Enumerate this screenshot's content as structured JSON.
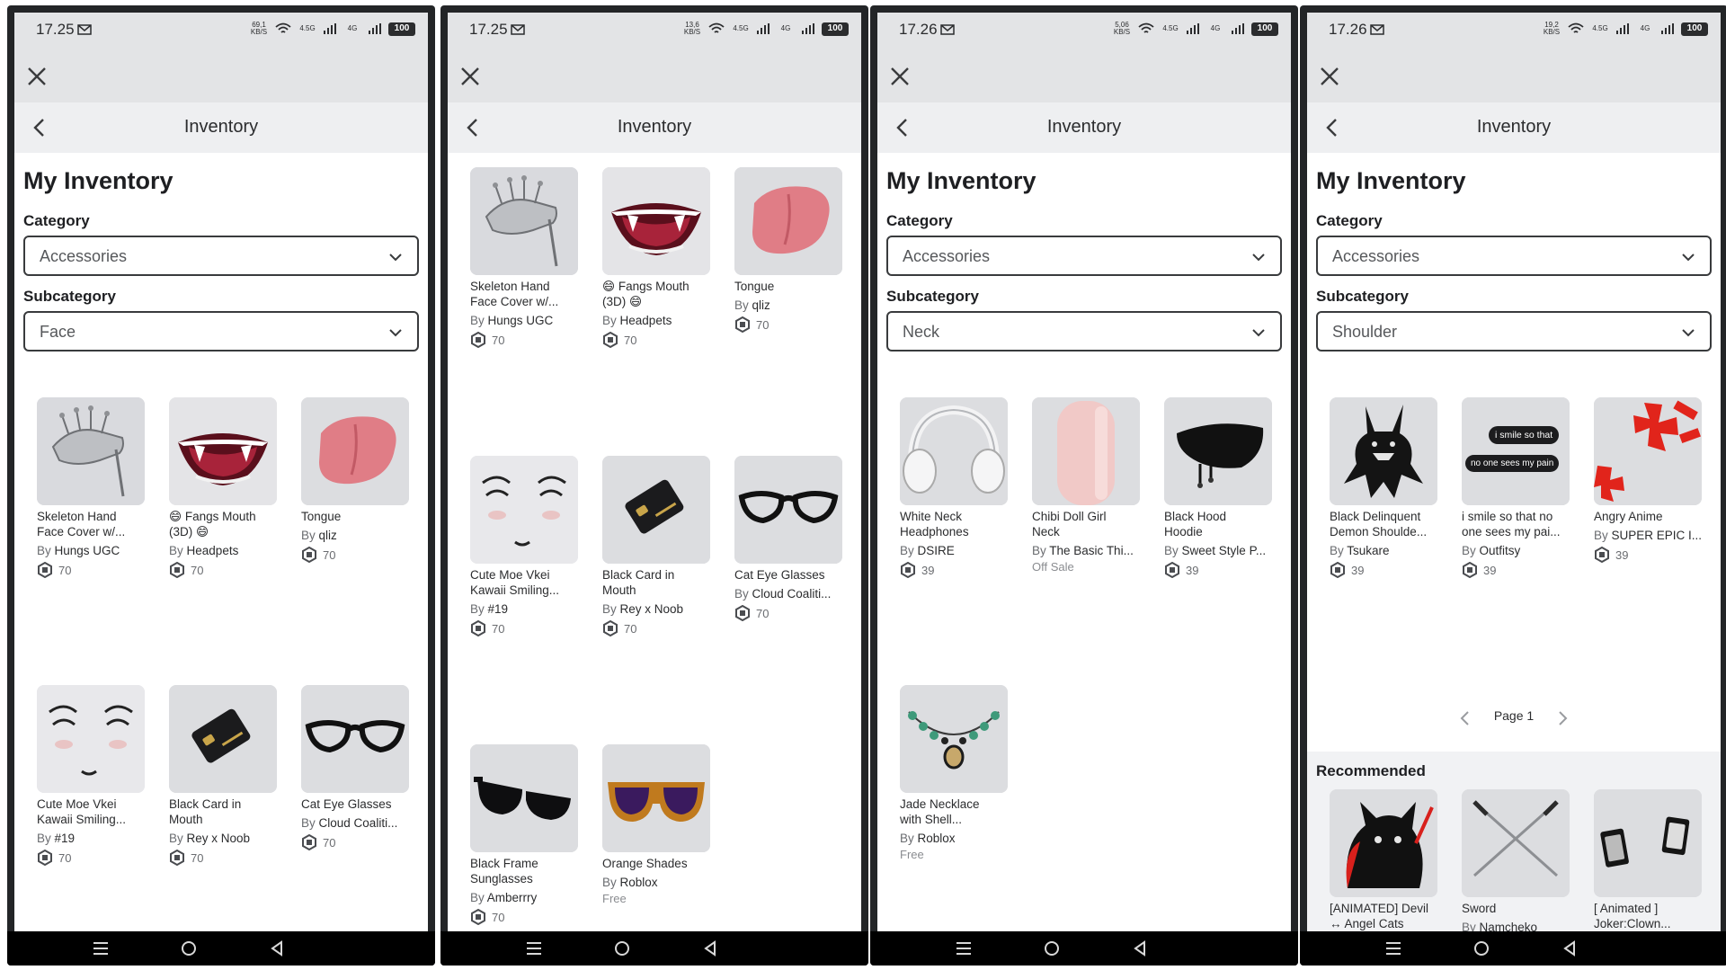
{
  "colors": {
    "accent_dark": "#1e1f22",
    "panel_bg": "#e3e4e6",
    "nav_bg": "#eeeff1",
    "thumb_bg": "#dcdde0",
    "muted": "#6a6c70"
  },
  "screens": [
    {
      "status": {
        "time": "17.25",
        "net_speed": "69,1 KB/S",
        "net_a": "4.5G",
        "net_b": "4G",
        "battery": "100"
      },
      "nav_title": "Inventory",
      "page_title": "My Inventory",
      "category_label": "Category",
      "category_value": "Accessories",
      "subcategory_label": "Subcategory",
      "subcategory_value": "Face",
      "items": [
        {
          "name": "Skeleton Hand\nFace Cover w/...",
          "by": "By",
          "creator": "Hungs UGC",
          "price": "70",
          "icon": "skeleton-hand"
        },
        {
          "name": "😄 Fangs Mouth\n(3D) 😄",
          "by": "By",
          "creator": "Headpets",
          "price": "70",
          "icon": "fangs-mouth"
        },
        {
          "name": "Tongue",
          "by": "By",
          "creator": "qliz",
          "price": "70",
          "icon": "tongue"
        },
        {
          "name": "Cute Moe Vkei\nKawaii Smiling...",
          "by": "By",
          "creator": "#19",
          "price": "70",
          "icon": "kawaii-face"
        },
        {
          "name": "Black Card in\nMouth",
          "by": "By",
          "creator": "Rey x Noob",
          "price": "70",
          "icon": "black-card"
        },
        {
          "name": "Cat Eye Glasses",
          "by": "By",
          "creator": "Cloud Coaliti...",
          "price": "70",
          "icon": "cat-eye-glasses"
        }
      ]
    },
    {
      "status": {
        "time": "17.25",
        "net_speed": "13,6 KB/S",
        "net_a": "4.5G",
        "net_b": "4G",
        "battery": "100"
      },
      "nav_title": "Inventory",
      "items": [
        {
          "name": "Skeleton Hand\nFace Cover w/...",
          "by": "By",
          "creator": "Hungs UGC",
          "price": "70",
          "icon": "skeleton-hand"
        },
        {
          "name": "😄 Fangs Mouth\n(3D) 😄",
          "by": "By",
          "creator": "Headpets",
          "price": "70",
          "icon": "fangs-mouth"
        },
        {
          "name": "Tongue",
          "by": "By",
          "creator": "qliz",
          "price": "70",
          "icon": "tongue"
        },
        {
          "name": "Cute Moe Vkei\nKawaii Smiling...",
          "by": "By",
          "creator": "#19",
          "price": "70",
          "icon": "kawaii-face"
        },
        {
          "name": "Black Card in\nMouth",
          "by": "By",
          "creator": "Rey x Noob",
          "price": "70",
          "icon": "black-card"
        },
        {
          "name": "Cat Eye Glasses",
          "by": "By",
          "creator": "Cloud Coaliti...",
          "price": "70",
          "icon": "cat-eye-glasses"
        },
        {
          "name": "Black Frame\nSunglasses",
          "by": "By",
          "creator": "Amberrry",
          "price": "70",
          "icon": "black-sunglasses"
        },
        {
          "name": "Orange Shades",
          "by": "By",
          "creator": "Roblox",
          "offsale": "Free",
          "icon": "orange-shades"
        }
      ]
    },
    {
      "status": {
        "time": "17.26",
        "net_speed": "5,06 KB/S",
        "net_a": "4.5G",
        "net_b": "4G",
        "battery": "100"
      },
      "nav_title": "Inventory",
      "page_title": "My Inventory",
      "category_label": "Category",
      "category_value": "Accessories",
      "subcategory_label": "Subcategory",
      "subcategory_value": "Neck",
      "items": [
        {
          "name": "White Neck\nHeadphones",
          "by": "By",
          "creator": "DSIRE",
          "price": "39",
          "icon": "headphones"
        },
        {
          "name": "Chibi Doll Girl\nNeck",
          "by": "By",
          "creator": "The Basic Thi...",
          "offsale": "Off Sale",
          "icon": "doll-neck"
        },
        {
          "name": "Black Hood\nHoodie",
          "by": "By",
          "creator": "Sweet Style P...",
          "price": "39",
          "icon": "black-hood"
        },
        {
          "name": "Jade Necklace\nwith Shell...",
          "by": "By",
          "creator": "Roblox",
          "offsale": "Free",
          "icon": "jade-necklace"
        }
      ]
    },
    {
      "status": {
        "time": "17.26",
        "net_speed": "19,2 KB/S",
        "net_a": "4.5G",
        "net_b": "4G",
        "battery": "100"
      },
      "nav_title": "Inventory",
      "page_title": "My Inventory",
      "category_label": "Category",
      "category_value": "Accessories",
      "subcategory_label": "Subcategory",
      "subcategory_value": "Shoulder",
      "items": [
        {
          "name": "Black Delinquent\nDemon Shoulde...",
          "by": "By",
          "creator": "Tsukare",
          "price": "39",
          "icon": "demon"
        },
        {
          "name": "i smile so that no\none sees my pai...",
          "by": "By",
          "creator": "Outfitsy",
          "price": "39",
          "icon": "speech-bubbles",
          "bubble_a": "i smile so that",
          "bubble_b": "no one sees my pain"
        },
        {
          "name": "Angry Anime",
          "by": "By",
          "creator": "SUPER EPIC I...",
          "price": "39",
          "icon": "angry-anime"
        }
      ],
      "pager": {
        "text": "Page 1"
      },
      "recommended_title": "Recommended",
      "recommended": [
        {
          "name": "[ANIMATED] Devil\n↔ Angel Cats",
          "icon": "devil-cat"
        },
        {
          "name": "Sword",
          "by": "By",
          "creator": "Namcheko",
          "icon": "sword"
        },
        {
          "name": "[ Animated ]\nJoker:Clown...",
          "icon": "joker-cards"
        }
      ]
    }
  ]
}
